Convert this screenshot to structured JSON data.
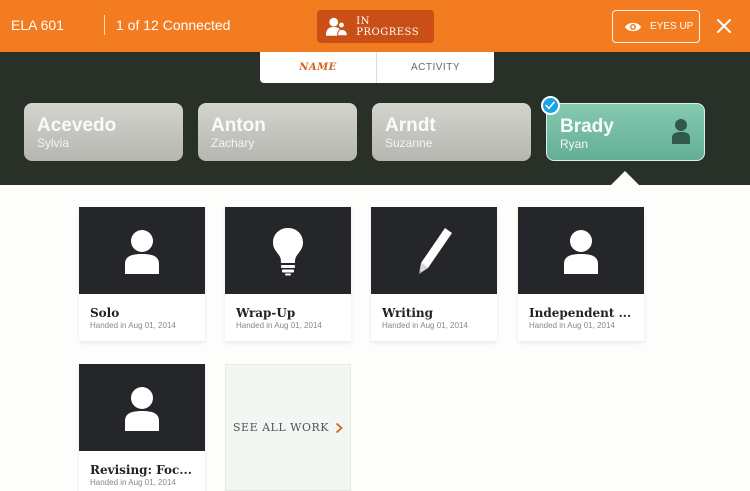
{
  "header": {
    "class_name": "ELA 601",
    "connected": "1 of 12 Connected",
    "status": "IN PROGRESS",
    "eyes_up": "EYES UP"
  },
  "sort_tabs": [
    {
      "label": "NAME",
      "active": true
    },
    {
      "label": "ACTIVITY",
      "active": false
    }
  ],
  "students": [
    {
      "last": "Acevedo",
      "first": "Sylvia"
    },
    {
      "last": "Anton",
      "first": "Zachary"
    },
    {
      "last": "Arndt",
      "first": "Suzanne"
    },
    {
      "last": "Brady",
      "first": "Ryan",
      "selected": true
    }
  ],
  "work": [
    {
      "title": "Solo",
      "date": "Handed in Aug 01, 2014",
      "icon": "person-icon"
    },
    {
      "title": "Wrap-Up",
      "date": "Handed in Aug 01, 2014",
      "icon": "lightbulb-icon"
    },
    {
      "title": "Writing",
      "date": "Handed in Aug 01, 2014",
      "icon": "pencil-icon"
    },
    {
      "title": "Independent ...",
      "date": "Handed in Aug 01, 2014",
      "icon": "person-icon"
    },
    {
      "title": "Revising: Foc...",
      "date": "Handed in Aug 01, 2014",
      "icon": "person-icon"
    }
  ],
  "see_all": "SEE ALL WORK",
  "colors": {
    "top_bar": "#f47c20",
    "status_pill": "#c94f16",
    "dark_bg": "#283028",
    "selected_card": "#6bb59b",
    "check_badge": "#1aa3e8"
  }
}
